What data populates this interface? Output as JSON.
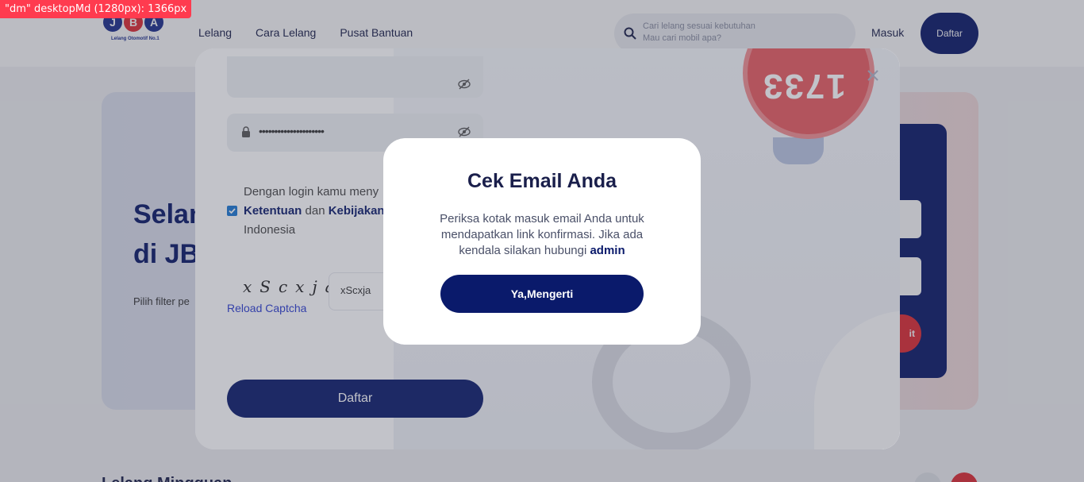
{
  "debug": {
    "label": "\"dm\" desktopMd (1280px): 1366px"
  },
  "header": {
    "logo": {
      "letters": [
        "J",
        "B",
        "A"
      ],
      "tagline": "Lelang Otomotif No.1"
    },
    "nav": [
      "Lelang",
      "Cara Lelang",
      "Pusat Bantuan"
    ],
    "search": {
      "placeholder_line1": "Cari lelang sesuai kebutuhan",
      "placeholder_line2": "Mau cari mobil apa?"
    },
    "login_label": "Masuk",
    "register_label": "Daftar"
  },
  "hero": {
    "title_line1": "Selam",
    "title_line2": "di JBA",
    "subtitle": "Pilih filter pe",
    "button_label": "it"
  },
  "section": {
    "title": "Lelang Mingguan"
  },
  "register_modal": {
    "password_dots": "•••••••••••••••••••••",
    "terms_line1": "Dengan login kamu meny",
    "terms_line2_bold1": "Ketentuan",
    "terms_line2_mid": " dan ",
    "terms_line2_bold2": "Kebijakan",
    "terms_line3": "Indonesia",
    "captcha_text": "xScxja",
    "captcha_value": "xScxja",
    "reload_label": "Reload Captcha",
    "submit_label": "Daftar",
    "sign_number": "1733"
  },
  "dialog": {
    "title": "Cek Email Anda",
    "body_text": "Periksa kotak masuk email Anda untuk mendapatkan link konfirmasi. Jika ada kendala silakan hubungi ",
    "body_link": "admin",
    "ok_label": "Ya,Mengerti"
  },
  "colors": {
    "primary": "#0a1a6b",
    "accent": "#e32b33",
    "link": "#2b3ccf"
  }
}
